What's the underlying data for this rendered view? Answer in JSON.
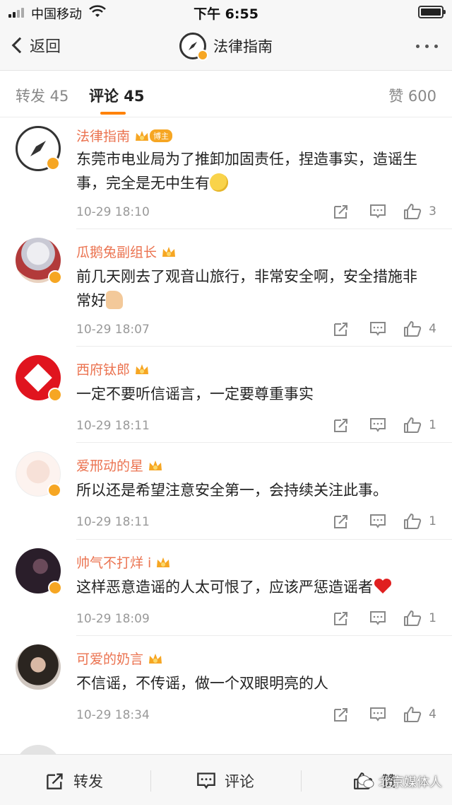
{
  "status_bar": {
    "carrier": "中国移动",
    "time": "下午 6:55"
  },
  "nav": {
    "back_label": "返回",
    "title": "法律指南"
  },
  "tabs": [
    {
      "label": "转发 45"
    },
    {
      "label": "评论 45",
      "active": true
    },
    {
      "label": "赞 600"
    }
  ],
  "comments": [
    {
      "name": "法律指南",
      "tag": "博主",
      "text": "东莞市电业局为了推卸加固责任，捏造事实，造谣生事，完全是无中生有",
      "emoji": "smile",
      "time": "10-29 18:10",
      "likes": "3"
    },
    {
      "name": "瓜鹅兔副组长",
      "text": "前几天刚去了观音山旅行，非常安全啊，安全措施非常好",
      "emoji": "thumbs-up",
      "time": "10-29 18:07",
      "likes": "4"
    },
    {
      "name": "西府钛郎",
      "text": "一定不要听信谣言，一定要尊重事实",
      "time": "10-29 18:11",
      "likes": "1"
    },
    {
      "name": "爱邢动的星",
      "text": "所以还是希望注意安全第一，会持续关注此事。",
      "time": "10-29 18:11",
      "likes": "1"
    },
    {
      "name": "帅气不打烊 i",
      "text": "这样恶意造谣的人太可恨了，应该严惩造谣者",
      "emoji": "heart",
      "time": "10-29 18:09",
      "likes": "1"
    },
    {
      "name": "可爱的奶言",
      "text": "不信谣，不传谣，做一个双眼明亮的人",
      "time": "10-29 18:34",
      "likes": "4"
    }
  ],
  "bottom_bar": {
    "repost_label": "转发",
    "comment_label": "评论",
    "like_label": "赞"
  },
  "watermark": "北京媒体人",
  "colors": {
    "accent": "#ff8200",
    "username": "#eb7350",
    "badge": "#f6a623"
  }
}
